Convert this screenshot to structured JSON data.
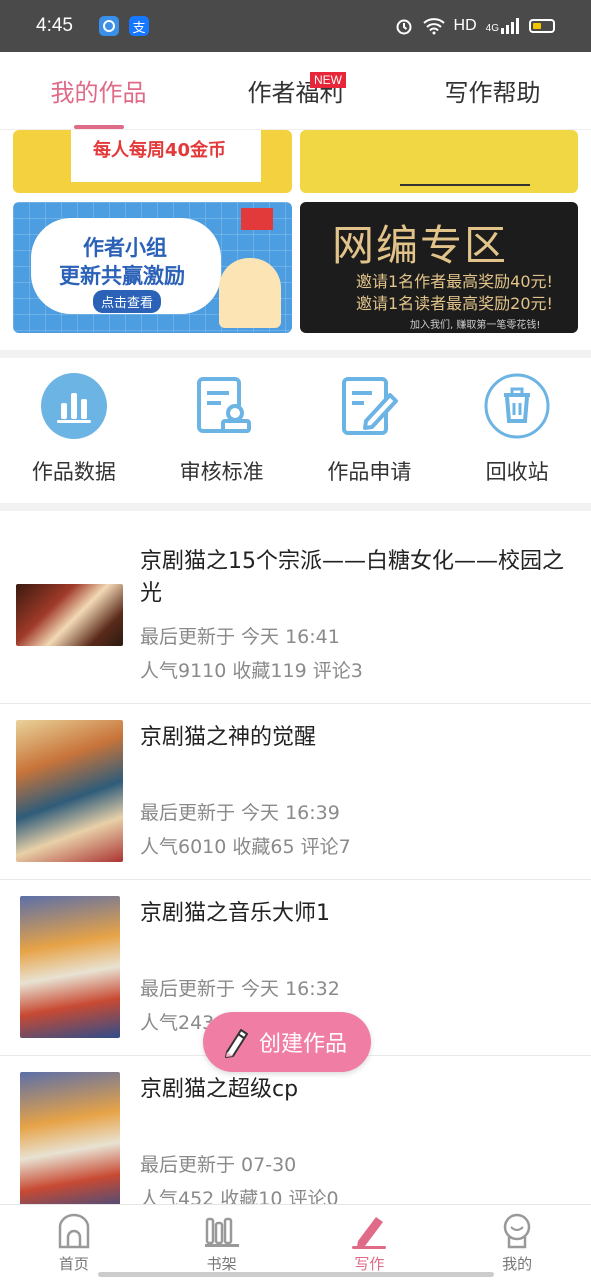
{
  "status_bar": {
    "time": "4:45",
    "network": "HD",
    "signal": "4G"
  },
  "tabs": [
    {
      "label": "我的作品",
      "active": true
    },
    {
      "label": "作者福利",
      "badge": "NEW"
    },
    {
      "label": "写作帮助"
    }
  ],
  "banners": {
    "weekly_coins": "每人每周40金币",
    "author_group_line1": "作者小组",
    "author_group_line2": "更新共赢激励",
    "author_group_button": "点击查看",
    "editor_zone_title": "网编专区",
    "editor_zone_line1": "邀请1名作者最高奖励40元!",
    "editor_zone_line2": "邀请1名读者最高奖励20元!",
    "editor_zone_footer": "加入我们, 赚取第一笔零花钱!"
  },
  "actions": [
    {
      "label": "作品数据",
      "icon": "bar-chart-icon"
    },
    {
      "label": "审核标准",
      "icon": "review-stamp-icon"
    },
    {
      "label": "作品申请",
      "icon": "edit-document-icon"
    },
    {
      "label": "回收站",
      "icon": "trash-icon"
    }
  ],
  "works": [
    {
      "title": "京剧猫之15个宗派——白糖女化——校园之光",
      "updated": "最后更新于 今天 16:41",
      "stats": "人气9110 收藏119 评论3"
    },
    {
      "title": "京剧猫之神的觉醒",
      "updated": "最后更新于 今天 16:39",
      "stats": "人气6010 收藏65 评论7"
    },
    {
      "title": "京剧猫之音乐大师1",
      "updated": "最后更新于 今天 16:32",
      "stats": "人气243"
    },
    {
      "title": "京剧猫之超级cp",
      "updated": "最后更新于 07-30",
      "stats": "人气452 收藏10 评论0"
    }
  ],
  "fab": {
    "label": "创建作品"
  },
  "bottom_nav": [
    {
      "label": "首页",
      "icon": "home-icon"
    },
    {
      "label": "书架",
      "icon": "bookshelf-icon"
    },
    {
      "label": "写作",
      "icon": "pen-icon",
      "active": true
    },
    {
      "label": "我的",
      "icon": "profile-icon"
    }
  ],
  "colors": {
    "accent": "#e06b88",
    "fab": "#f07ea4",
    "icon_blue": "#6cb4e4",
    "badge_red": "#e8263a"
  }
}
